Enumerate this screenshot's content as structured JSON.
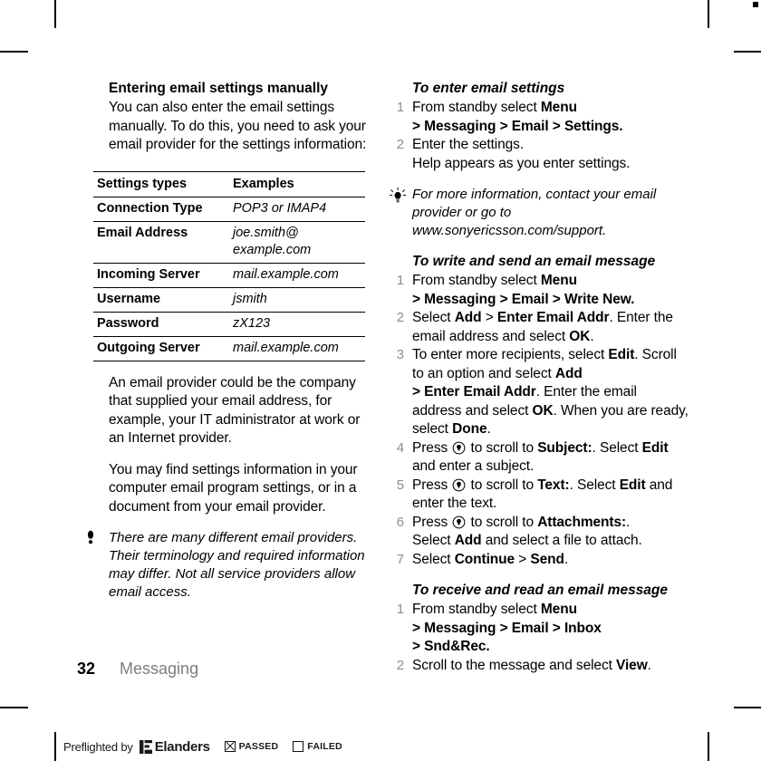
{
  "page": {
    "number": "32",
    "chapter": "Messaging"
  },
  "left_column": {
    "section_heading": "Entering email settings manually",
    "intro_paragraph": "You can also enter the email settings manually. To do this, you need to ask your email provider for the settings information:",
    "table": {
      "headers": [
        "Settings types",
        "Examples"
      ],
      "rows": [
        {
          "type": "Connection Type",
          "example": "POP3 or IMAP4"
        },
        {
          "type": "Email Address",
          "example": "joe.smith@ example.com"
        },
        {
          "type": "Incoming Server",
          "example": "mail.example.com"
        },
        {
          "type": "Username",
          "example": "jsmith"
        },
        {
          "type": "Password",
          "example": "zX123"
        },
        {
          "type": "Outgoing Server",
          "example": "mail.example.com"
        }
      ]
    },
    "paragraph_provider": "An email provider could be the company that supplied your email address, for example, your IT administrator at work or an Internet provider.",
    "paragraph_settings": "You may find settings information in your computer email program settings, or in a document from your email provider.",
    "note": {
      "icon": "exclamation-note-icon",
      "text": "There are many different email providers. Their terminology and required information may differ. Not all service providers allow email access."
    }
  },
  "right_column": {
    "procedure_enter_settings": {
      "heading": "To enter email settings",
      "steps": [
        {
          "num": "1",
          "line1_pre": "From standby select ",
          "line1_bold": "Menu",
          "line2": "> Messaging > Email > Settings."
        },
        {
          "num": "2",
          "line1": "Enter the settings.",
          "line2": "Help appears as you enter settings."
        }
      ]
    },
    "tip": {
      "icon": "lightbulb-tip-icon",
      "text": "For more information, contact your email provider or go to www.sonyericsson.com/support."
    },
    "procedure_write_send": {
      "heading": "To write and send an email message",
      "steps": [
        {
          "num": "1"
        },
        {
          "num": "2"
        },
        {
          "num": "3"
        },
        {
          "num": "4"
        },
        {
          "num": "5"
        },
        {
          "num": "6"
        },
        {
          "num": "7"
        }
      ]
    },
    "procedure_receive_read": {
      "heading": "To receive and read an email message",
      "steps": [
        {
          "num": "1"
        },
        {
          "num": "2"
        }
      ]
    },
    "strings": {
      "from_standby_select": "From standby select ",
      "menu": "Menu",
      "path_messaging_email_settings": "> Messaging > Email > Settings.",
      "enter_the_settings": "Enter the settings.",
      "help_appears": "Help appears as you enter settings.",
      "path_messaging_email_writenew": "> Messaging > Email > Write New.",
      "s2_select": "Select ",
      "s2_add": "Add",
      "s2_gt": " > ",
      "s2_enter_email_addr": "Enter Email Addr",
      "s2_tail": ". Enter the email address and select ",
      "s2_ok": "OK",
      "s2_period": ".",
      "s3_pre": "To enter more recipients, select ",
      "s3_edit": "Edit",
      "s3_mid": ". Scroll to an option and select ",
      "s3_add": "Add",
      "s3_path": "> Enter Email Addr",
      "s3_tail": ". Enter the email address and select ",
      "s3_ok": "OK",
      "s3_ready": ". When you are ready, select ",
      "s3_done": "Done",
      "s3_end": ".",
      "press": "Press ",
      "to_scroll_to": " to scroll to ",
      "subject": "Subject:",
      "select_word": ". Select ",
      "edit": "Edit",
      "s4_tail": " and enter a subject.",
      "text_field": "Text:",
      "s5_tail": " and enter the text.",
      "attachments": "Attachments:",
      "s6_select": "Select ",
      "s6_add": "Add",
      "s6_tail": " and select a file to attach.",
      "s7_select": "Select ",
      "s7_continue": "Continue",
      "s7_gt": " > ",
      "s7_send": "Send",
      "s7_end": ".",
      "path_messaging_email_inbox": "> Messaging > Email > Inbox",
      "path_sndrec": "> Snd&Rec.",
      "r2_pre": "Scroll to the message and select ",
      "r2_view": "View",
      "r2_end": ".",
      "navkey_icon": "navigation-key-down-icon"
    }
  },
  "preflight": {
    "label": "Preflighted by",
    "brand": "Elanders",
    "logo_icon": "elanders-logo-icon",
    "passed_label": "PASSED",
    "failed_label": "FAILED",
    "passed_checked": "true"
  },
  "colors": {
    "text": "#000000",
    "step_number": "#8d8d8d",
    "chapter_label": "#7d7d7d",
    "rule": "#000000"
  }
}
